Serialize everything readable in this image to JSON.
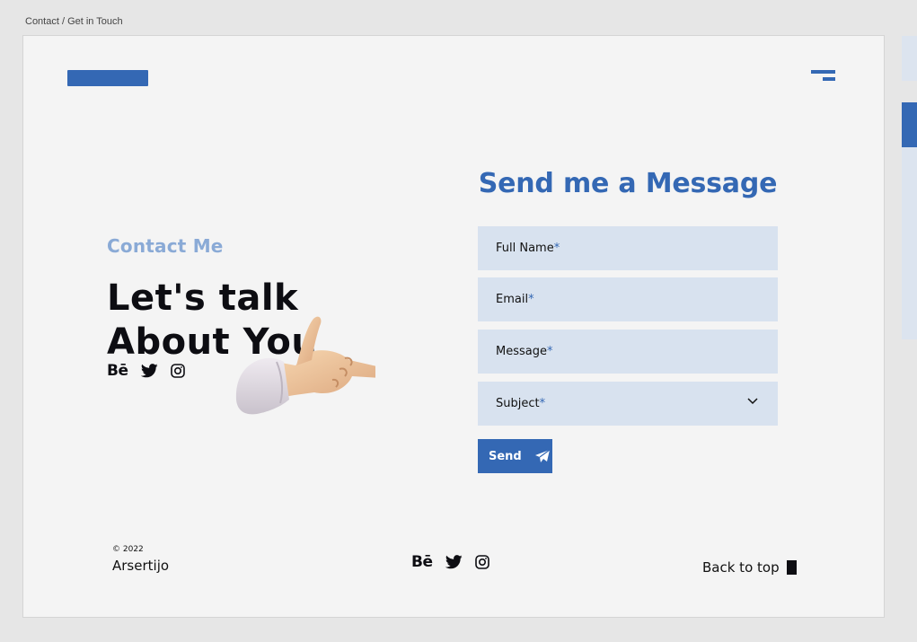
{
  "breadcrumb": "Contact / Get in Touch",
  "hero": {
    "label": "Contact Me",
    "title_line1": "Let's talk",
    "title_line2": "About You"
  },
  "form": {
    "title": "Send me a Message",
    "fields": [
      {
        "label": "Full Name",
        "required": "*"
      },
      {
        "label": "Email",
        "required": "*"
      },
      {
        "label": "Message",
        "required": "*"
      },
      {
        "label": "Subject",
        "required": "*"
      }
    ],
    "send_label": "Send"
  },
  "social": {
    "behance": "Bē"
  },
  "footer": {
    "copyright": "© 2022",
    "brand": "Arsertijo",
    "back_to_top": "Back to top"
  },
  "colors": {
    "accent": "#3468b4",
    "label": "#8aaad6",
    "field_bg": "#d8e2ef"
  },
  "icons": [
    "menu-icon",
    "twitter-icon",
    "instagram-icon",
    "chevron-down-icon",
    "paper-plane-icon"
  ]
}
